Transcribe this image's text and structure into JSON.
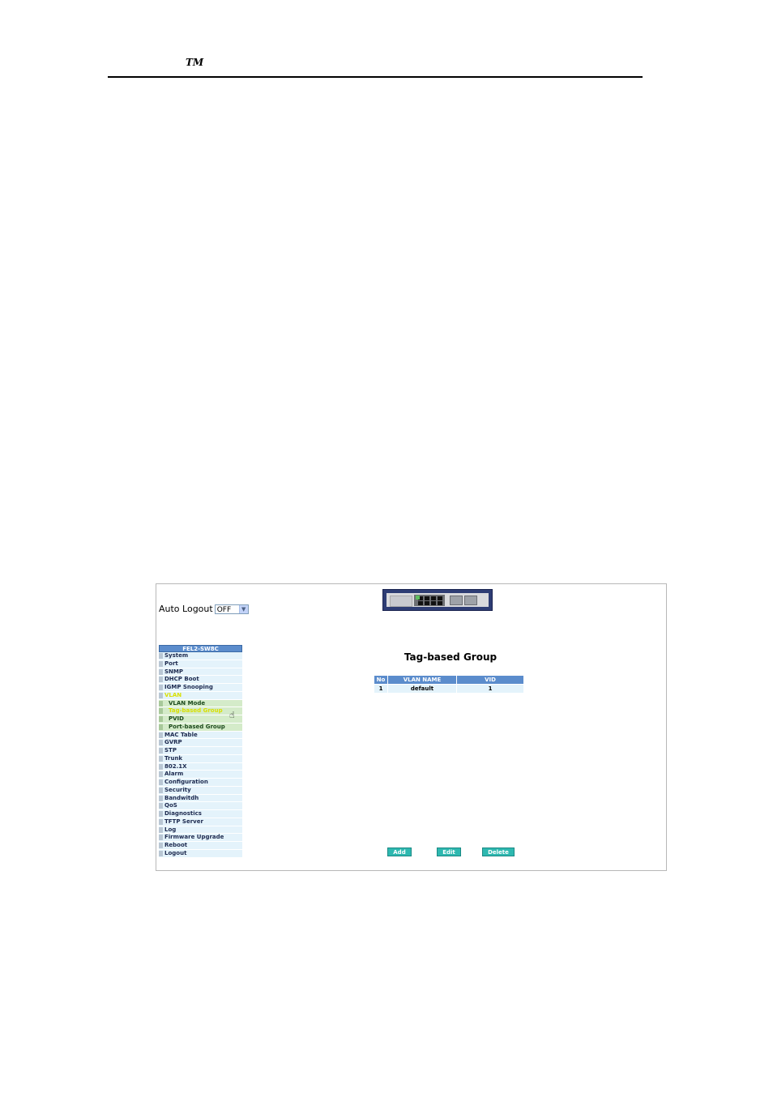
{
  "doc": {
    "tm": "TM"
  },
  "header": {
    "auto_logout_label": "Auto Logout",
    "auto_logout_value": "OFF"
  },
  "menu": {
    "title": "FEL2-SW8C",
    "items": [
      {
        "label": "System",
        "type": "item"
      },
      {
        "label": "Port",
        "type": "item"
      },
      {
        "label": "SNMP",
        "type": "item"
      },
      {
        "label": "DHCP Boot",
        "type": "item"
      },
      {
        "label": "IGMP Snooping",
        "type": "item"
      },
      {
        "label": "VLAN",
        "type": "open"
      },
      {
        "label": "VLAN Mode",
        "type": "sub"
      },
      {
        "label": "Tag-based Group",
        "type": "sub-active"
      },
      {
        "label": "PVID",
        "type": "sub"
      },
      {
        "label": "Port-based Group",
        "type": "sub"
      },
      {
        "label": "MAC Table",
        "type": "item"
      },
      {
        "label": "GVRP",
        "type": "item"
      },
      {
        "label": "STP",
        "type": "item"
      },
      {
        "label": "Trunk",
        "type": "item"
      },
      {
        "label": "802.1X",
        "type": "item"
      },
      {
        "label": "Alarm",
        "type": "item"
      },
      {
        "label": "Configuration",
        "type": "item"
      },
      {
        "label": "Security",
        "type": "item"
      },
      {
        "label": "Bandwitdh",
        "type": "item"
      },
      {
        "label": "QoS",
        "type": "item"
      },
      {
        "label": "Diagnostics",
        "type": "item"
      },
      {
        "label": "TFTP Server",
        "type": "item"
      },
      {
        "label": "Log",
        "type": "item"
      },
      {
        "label": "Firmware Upgrade",
        "type": "item"
      },
      {
        "label": "Reboot",
        "type": "item"
      },
      {
        "label": "Logout",
        "type": "item"
      }
    ]
  },
  "main": {
    "title": "Tag-based Group",
    "table": {
      "columns": [
        "No",
        "VLAN NAME",
        "VID"
      ],
      "rows": [
        [
          "1",
          "default",
          "1"
        ]
      ]
    },
    "buttons": {
      "add": "Add",
      "edit": "Edit",
      "delete": "Delete"
    }
  },
  "colors": {
    "menu_header": "#5b8ccc",
    "menu_item_bg": "#e4f3fb",
    "submenu_bg": "#d4ebc9",
    "active_text": "#d9e000",
    "button_bg": "#2eb8b0"
  }
}
